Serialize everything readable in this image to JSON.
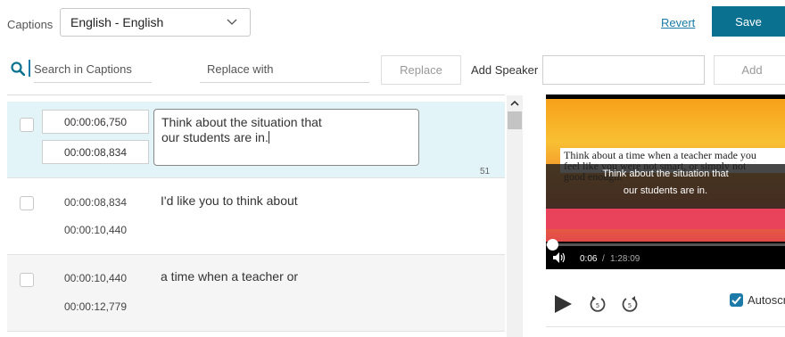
{
  "header": {
    "captions_label": "Captions",
    "language": "English - English",
    "revert_label": "Revert",
    "save_label": "Save"
  },
  "toolbar": {
    "search_placeholder": "Search in Captions",
    "replace_placeholder": "Replace with",
    "replace_label": "Replace",
    "add_speaker_label": "Add Speaker",
    "add_label": "Add"
  },
  "captions": [
    {
      "start": "00:00:06,750",
      "end": "00:00:08,834",
      "text": "Think about the situation that\nour students are in.",
      "char_count": "51"
    },
    {
      "start": "00:00:08,834",
      "end": "00:00:10,440",
      "text": "I'd like you to think about"
    },
    {
      "start": "00:00:10,440",
      "end": "00:00:12,779",
      "text": "a time when a teacher or"
    }
  ],
  "video": {
    "slide_text": "Think about a time when a teacher made you\nfeel like you were not smart, or simply not\ngood enough.",
    "caption_overlay": "Think about the situation that\nour students are in.",
    "current_time": "0:06",
    "separator": "/",
    "total_time": "1:28:09",
    "progress": 0.0,
    "colors": {
      "slide_top": "#f7a11a",
      "slide_bottom": "#e24a4a"
    }
  },
  "controls": {
    "autoscroll_label": "Autoscroll",
    "autoscroll_checked": true
  },
  "colors": {
    "accent": "#0b7190",
    "link": "#1b7aa8",
    "selected_row": "#e3f4f8"
  }
}
